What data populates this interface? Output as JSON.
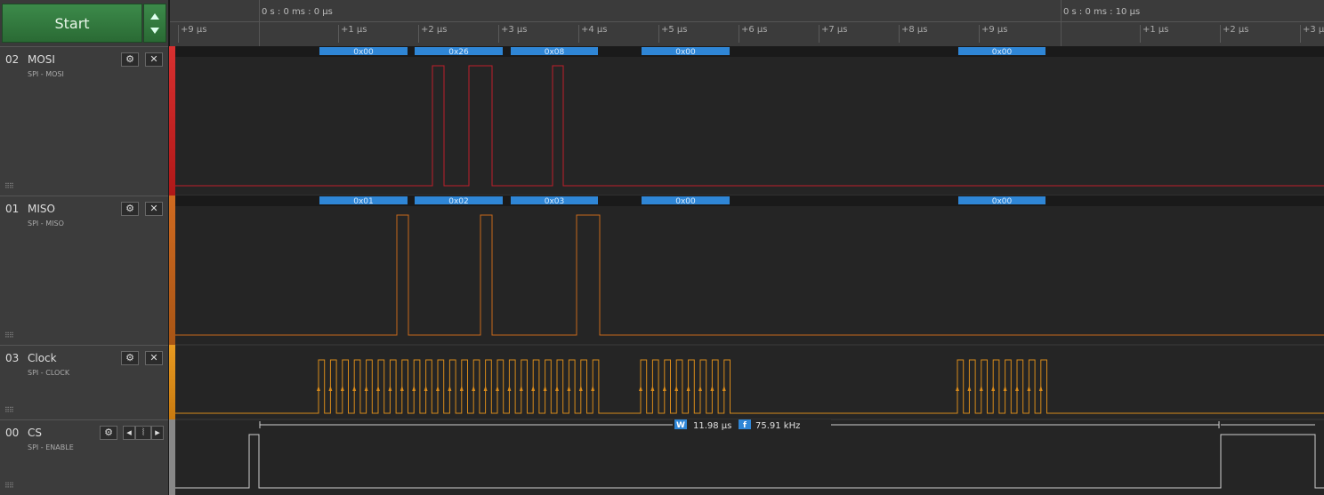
{
  "start_button": {
    "label": "Start"
  },
  "ruler": {
    "abs_labels": [
      "0 s : 0 ms : 0 µs",
      "0 s : 0 ms : 10 µs"
    ],
    "ticks": [
      "+9 µs",
      "+1 µs",
      "+2 µs",
      "+3 µs",
      "+4 µs",
      "+5 µs",
      "+6 µs",
      "+7 µs",
      "+8 µs",
      "+9 µs",
      "+1 µs",
      "+2 µs",
      "+3 µs"
    ]
  },
  "channels": [
    {
      "num": "02",
      "name": "MOSI",
      "sub": "SPI - MOSI",
      "color": "#c0202a",
      "decoded": [
        "0x00",
        "0x26",
        "0x08",
        "0x00",
        "0x00"
      ]
    },
    {
      "num": "01",
      "name": "MISO",
      "sub": "SPI - MISO",
      "color": "#c8691a",
      "decoded": [
        "0x01",
        "0x02",
        "0x03",
        "0x00",
        "0x00"
      ]
    },
    {
      "num": "03",
      "name": "Clock",
      "sub": "SPI - CLOCK",
      "color": "#d88a1a"
    },
    {
      "num": "00",
      "name": "CS",
      "sub": "SPI - ENABLE",
      "color": "#cfcfcf"
    }
  ],
  "measurement": {
    "width_badge": "W",
    "width": "11.98 µs",
    "freq_badge": "f",
    "freq": "75.91 kHz"
  },
  "colors": {
    "decode_bar": "#2f86d6",
    "accent": "#3c8a4a"
  }
}
